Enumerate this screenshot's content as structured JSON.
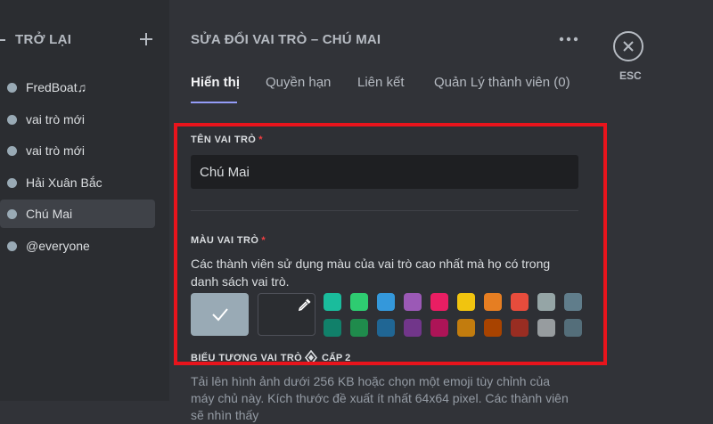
{
  "sidebar": {
    "back_label": "TRỞ LẠI",
    "roles": [
      {
        "label": "FredBoat♫",
        "selected": false
      },
      {
        "label": "vai trò mới",
        "selected": false
      },
      {
        "label": "vai trò mới",
        "selected": false
      },
      {
        "label": "Hải Xuân Bắc",
        "selected": false
      },
      {
        "label": "Chú Mai",
        "selected": true
      },
      {
        "label": "@everyone",
        "selected": false
      }
    ]
  },
  "header": {
    "title": "SỬA ĐỔI VAI TRÒ – CHÚ MAI",
    "esc_label": "ESC"
  },
  "tabs": [
    {
      "label": "Hiển thị",
      "active": true
    },
    {
      "label": "Quyền hạn",
      "active": false
    },
    {
      "label": "Liên kết",
      "active": false
    },
    {
      "label": "Quản Lý thành viên (0)",
      "active": false
    }
  ],
  "role_name": {
    "label": "TÊN VAI TRÒ",
    "required_mark": "*",
    "value": "Chú Mai"
  },
  "role_color": {
    "label": "MÀU VAI TRÒ",
    "required_mark": "*",
    "description": "Các thành viên sử dụng màu của vai trò cao nhất mà họ có trong danh sách vai trò.",
    "default_color": "#99aab5",
    "swatches_top": [
      "#1abc9c",
      "#2ecc71",
      "#3498db",
      "#9b59b6",
      "#e91e63",
      "#f1c40f",
      "#e67e22",
      "#e74c3c",
      "#95a5a6",
      "#607d8b"
    ],
    "swatches_bottom": [
      "#11806a",
      "#1f8b4c",
      "#206694",
      "#71368a",
      "#ad1457",
      "#c27c0e",
      "#a84300",
      "#992d22",
      "#979c9f",
      "#546e7a"
    ]
  },
  "role_icon": {
    "label": "BIỂU TƯỢNG VAI TRÒ",
    "level_badge": "CẤP 2",
    "description": "Tải lên hình ảnh dưới 256 KB hoặc chọn một emoji tùy chỉnh của máy chủ này. Kích thước đề xuất ít nhất 64x64 pixel. Các thành viên sẽ nhìn thấy"
  },
  "colors": {
    "highlight_box": "#e8141c",
    "tab_underline": "#949cf7"
  }
}
